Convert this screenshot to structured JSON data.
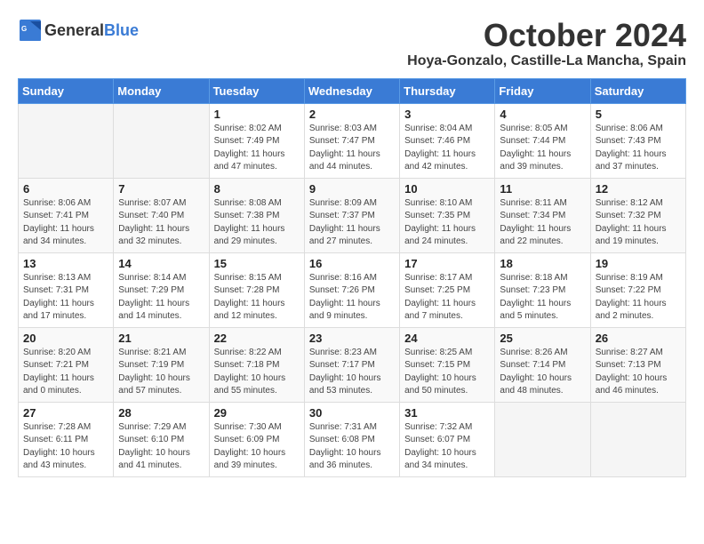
{
  "header": {
    "logo_general": "General",
    "logo_blue": "Blue",
    "month_title": "October 2024",
    "location": "Hoya-Gonzalo, Castille-La Mancha, Spain"
  },
  "calendar": {
    "day_headers": [
      "Sunday",
      "Monday",
      "Tuesday",
      "Wednesday",
      "Thursday",
      "Friday",
      "Saturday"
    ],
    "weeks": [
      [
        {
          "day": "",
          "info": ""
        },
        {
          "day": "",
          "info": ""
        },
        {
          "day": "1",
          "info": "Sunrise: 8:02 AM\nSunset: 7:49 PM\nDaylight: 11 hours and 47 minutes."
        },
        {
          "day": "2",
          "info": "Sunrise: 8:03 AM\nSunset: 7:47 PM\nDaylight: 11 hours and 44 minutes."
        },
        {
          "day": "3",
          "info": "Sunrise: 8:04 AM\nSunset: 7:46 PM\nDaylight: 11 hours and 42 minutes."
        },
        {
          "day": "4",
          "info": "Sunrise: 8:05 AM\nSunset: 7:44 PM\nDaylight: 11 hours and 39 minutes."
        },
        {
          "day": "5",
          "info": "Sunrise: 8:06 AM\nSunset: 7:43 PM\nDaylight: 11 hours and 37 minutes."
        }
      ],
      [
        {
          "day": "6",
          "info": "Sunrise: 8:06 AM\nSunset: 7:41 PM\nDaylight: 11 hours and 34 minutes."
        },
        {
          "day": "7",
          "info": "Sunrise: 8:07 AM\nSunset: 7:40 PM\nDaylight: 11 hours and 32 minutes."
        },
        {
          "day": "8",
          "info": "Sunrise: 8:08 AM\nSunset: 7:38 PM\nDaylight: 11 hours and 29 minutes."
        },
        {
          "day": "9",
          "info": "Sunrise: 8:09 AM\nSunset: 7:37 PM\nDaylight: 11 hours and 27 minutes."
        },
        {
          "day": "10",
          "info": "Sunrise: 8:10 AM\nSunset: 7:35 PM\nDaylight: 11 hours and 24 minutes."
        },
        {
          "day": "11",
          "info": "Sunrise: 8:11 AM\nSunset: 7:34 PM\nDaylight: 11 hours and 22 minutes."
        },
        {
          "day": "12",
          "info": "Sunrise: 8:12 AM\nSunset: 7:32 PM\nDaylight: 11 hours and 19 minutes."
        }
      ],
      [
        {
          "day": "13",
          "info": "Sunrise: 8:13 AM\nSunset: 7:31 PM\nDaylight: 11 hours and 17 minutes."
        },
        {
          "day": "14",
          "info": "Sunrise: 8:14 AM\nSunset: 7:29 PM\nDaylight: 11 hours and 14 minutes."
        },
        {
          "day": "15",
          "info": "Sunrise: 8:15 AM\nSunset: 7:28 PM\nDaylight: 11 hours and 12 minutes."
        },
        {
          "day": "16",
          "info": "Sunrise: 8:16 AM\nSunset: 7:26 PM\nDaylight: 11 hours and 9 minutes."
        },
        {
          "day": "17",
          "info": "Sunrise: 8:17 AM\nSunset: 7:25 PM\nDaylight: 11 hours and 7 minutes."
        },
        {
          "day": "18",
          "info": "Sunrise: 8:18 AM\nSunset: 7:23 PM\nDaylight: 11 hours and 5 minutes."
        },
        {
          "day": "19",
          "info": "Sunrise: 8:19 AM\nSunset: 7:22 PM\nDaylight: 11 hours and 2 minutes."
        }
      ],
      [
        {
          "day": "20",
          "info": "Sunrise: 8:20 AM\nSunset: 7:21 PM\nDaylight: 11 hours and 0 minutes."
        },
        {
          "day": "21",
          "info": "Sunrise: 8:21 AM\nSunset: 7:19 PM\nDaylight: 10 hours and 57 minutes."
        },
        {
          "day": "22",
          "info": "Sunrise: 8:22 AM\nSunset: 7:18 PM\nDaylight: 10 hours and 55 minutes."
        },
        {
          "day": "23",
          "info": "Sunrise: 8:23 AM\nSunset: 7:17 PM\nDaylight: 10 hours and 53 minutes."
        },
        {
          "day": "24",
          "info": "Sunrise: 8:25 AM\nSunset: 7:15 PM\nDaylight: 10 hours and 50 minutes."
        },
        {
          "day": "25",
          "info": "Sunrise: 8:26 AM\nSunset: 7:14 PM\nDaylight: 10 hours and 48 minutes."
        },
        {
          "day": "26",
          "info": "Sunrise: 8:27 AM\nSunset: 7:13 PM\nDaylight: 10 hours and 46 minutes."
        }
      ],
      [
        {
          "day": "27",
          "info": "Sunrise: 7:28 AM\nSunset: 6:11 PM\nDaylight: 10 hours and 43 minutes."
        },
        {
          "day": "28",
          "info": "Sunrise: 7:29 AM\nSunset: 6:10 PM\nDaylight: 10 hours and 41 minutes."
        },
        {
          "day": "29",
          "info": "Sunrise: 7:30 AM\nSunset: 6:09 PM\nDaylight: 10 hours and 39 minutes."
        },
        {
          "day": "30",
          "info": "Sunrise: 7:31 AM\nSunset: 6:08 PM\nDaylight: 10 hours and 36 minutes."
        },
        {
          "day": "31",
          "info": "Sunrise: 7:32 AM\nSunset: 6:07 PM\nDaylight: 10 hours and 34 minutes."
        },
        {
          "day": "",
          "info": ""
        },
        {
          "day": "",
          "info": ""
        }
      ]
    ]
  }
}
